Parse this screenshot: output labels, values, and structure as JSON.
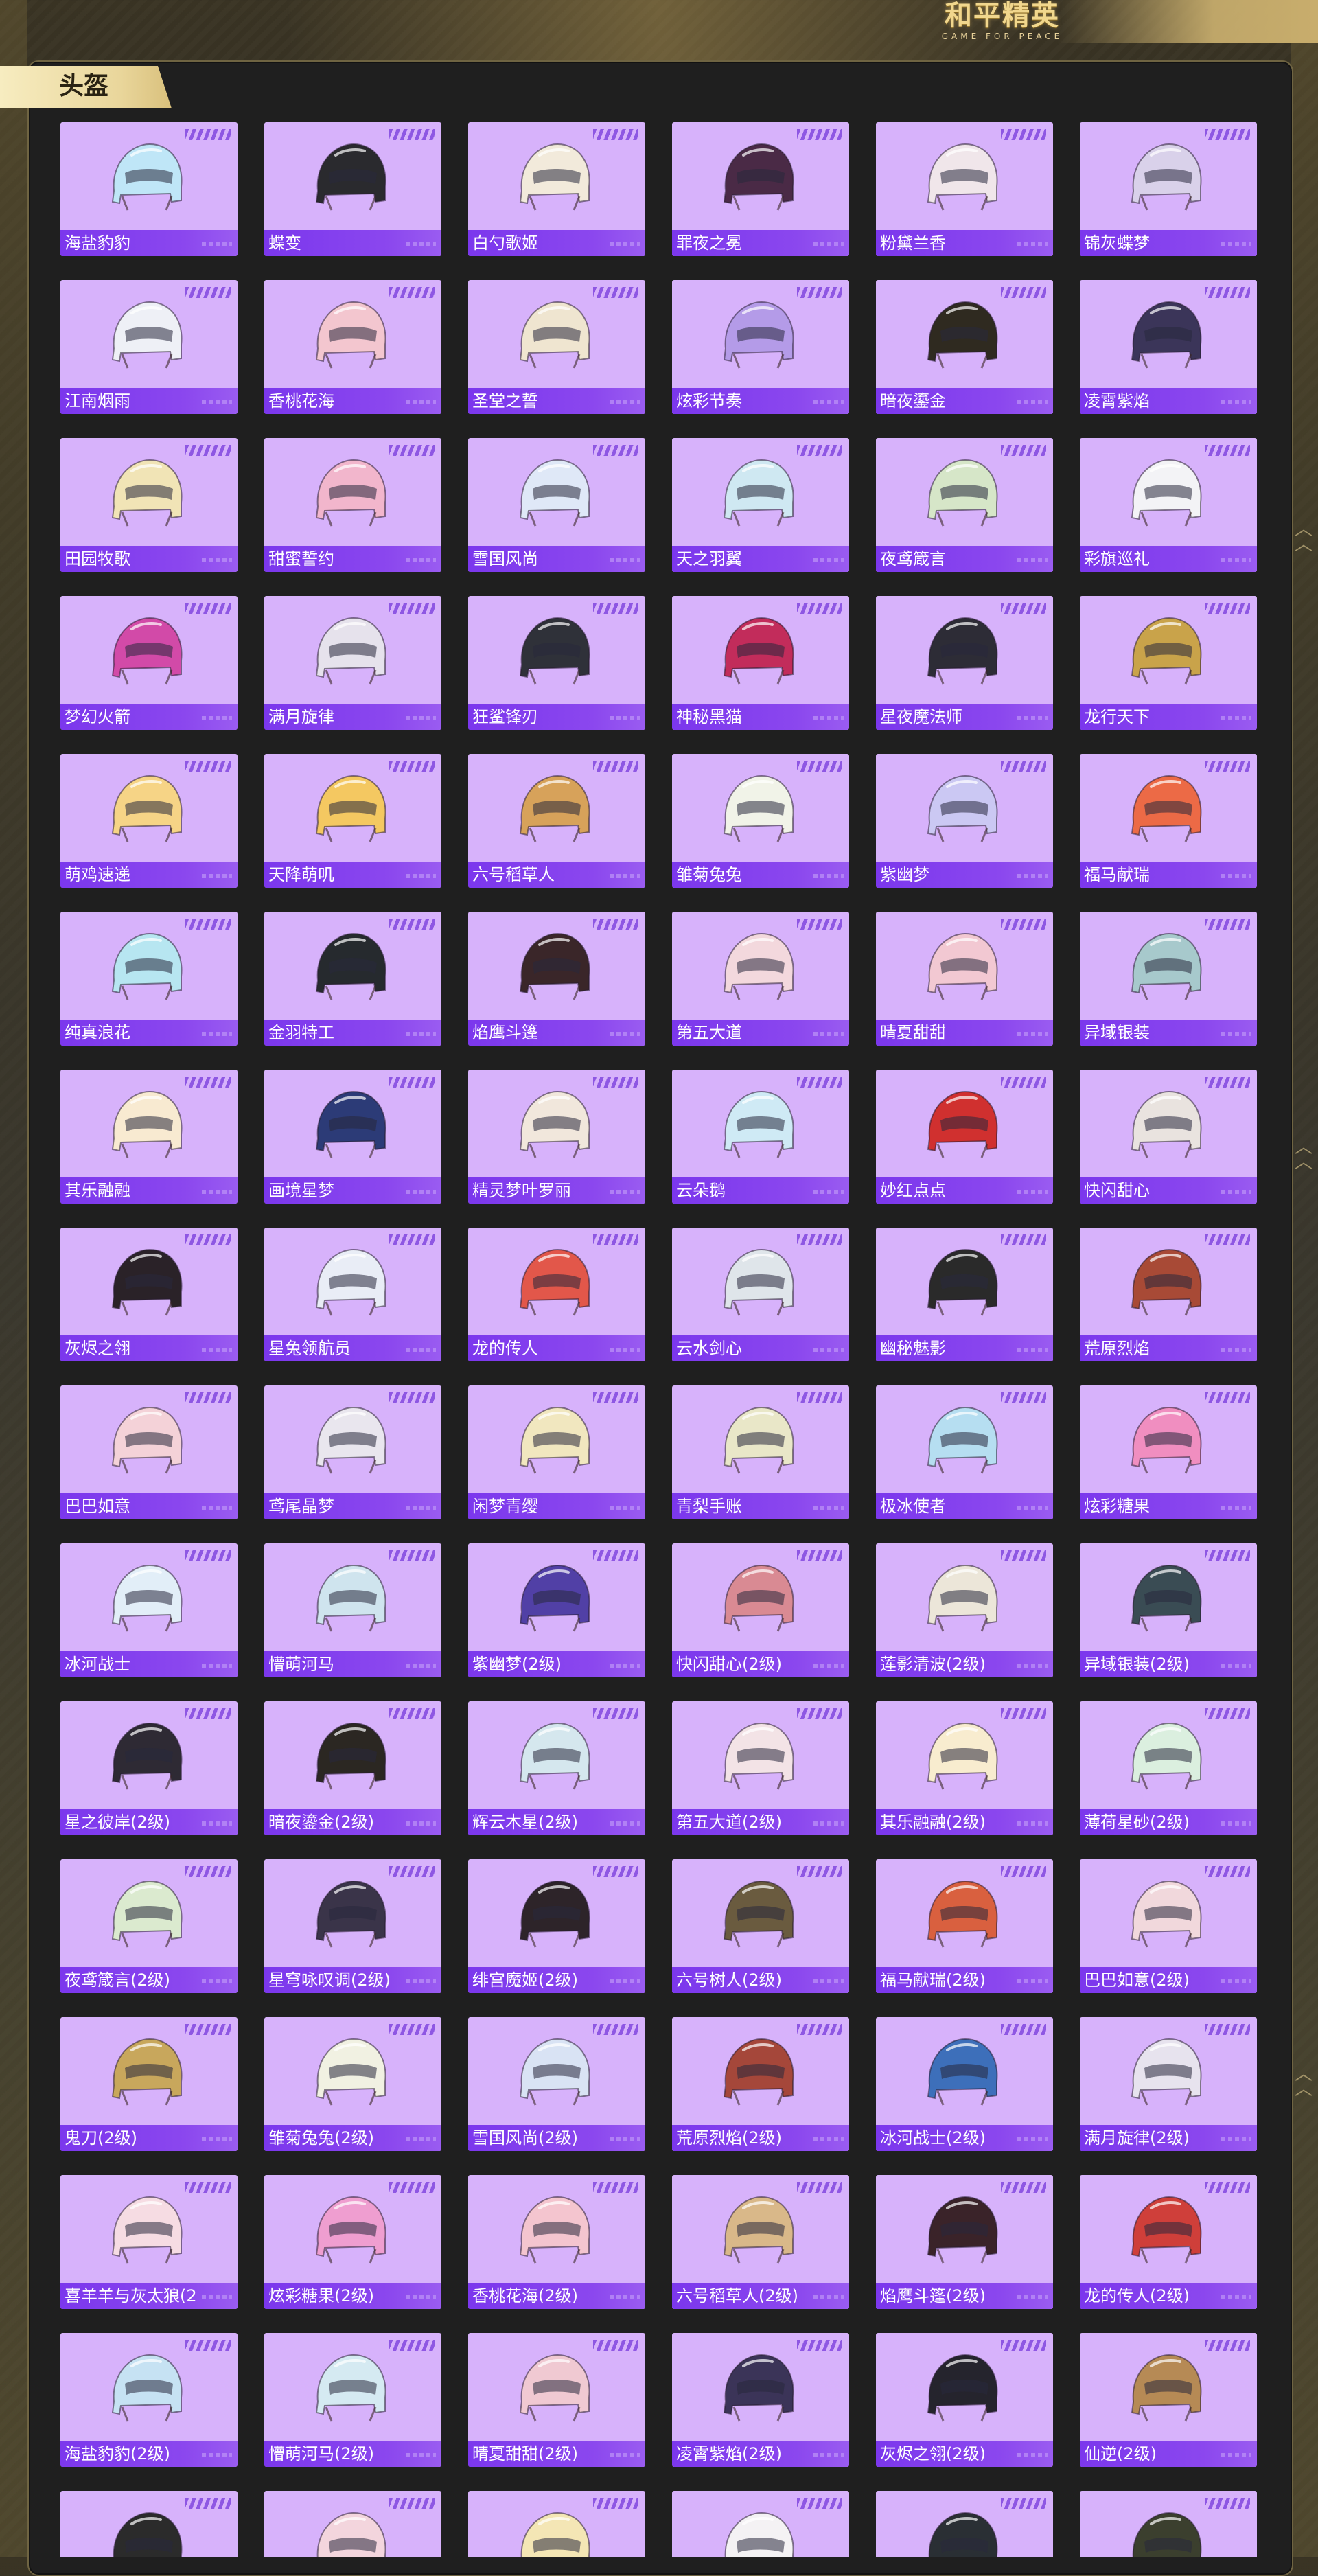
{
  "branding": {
    "logo_text": "和平精英",
    "logo_subtitle": "GAME FOR PEACE"
  },
  "section": {
    "title": "头盔"
  },
  "palette": {
    "card_bg": "#d7b2fb",
    "label_bar": "#7b37ed",
    "accent_gold": "#e9d69b"
  },
  "helmets": [
    {
      "name": "海盐豹豹",
      "icon": "helmet-icon",
      "color": "#bfe6f7"
    },
    {
      "name": "蝶变",
      "icon": "helmet-icon",
      "color": "#2a2a2e"
    },
    {
      "name": "白勺歌姬",
      "icon": "helmet-icon",
      "color": "#f2eadb"
    },
    {
      "name": "罪夜之冕",
      "icon": "helmet-icon",
      "color": "#4a2a46"
    },
    {
      "name": "粉黛兰香",
      "icon": "helmet-icon",
      "color": "#f0e6ea"
    },
    {
      "name": "锦灰蝶梦",
      "icon": "helmet-icon",
      "color": "#d9d1ea"
    },
    {
      "name": "江南烟雨",
      "icon": "helmet-icon",
      "color": "#eef0f6"
    },
    {
      "name": "香桃花海",
      "icon": "helmet-icon",
      "color": "#f3c6cf"
    },
    {
      "name": "圣堂之誓",
      "icon": "helmet-icon",
      "color": "#efe5d0"
    },
    {
      "name": "炫彩节奏",
      "icon": "helmet-icon",
      "color": "#b49be8"
    },
    {
      "name": "暗夜鎏金",
      "icon": "helmet-icon",
      "color": "#2f2a20"
    },
    {
      "name": "凌霄紫焰",
      "icon": "helmet-icon",
      "color": "#3b3559"
    },
    {
      "name": "田园牧歌",
      "icon": "helmet-icon",
      "color": "#f1e4b6"
    },
    {
      "name": "甜蜜誓约",
      "icon": "helmet-icon",
      "color": "#f2b6cc"
    },
    {
      "name": "雪国风尚",
      "icon": "helmet-icon",
      "color": "#dfe8f7"
    },
    {
      "name": "天之羽翼",
      "icon": "helmet-icon",
      "color": "#cfe8f2"
    },
    {
      "name": "夜鸢箴言",
      "icon": "helmet-icon",
      "color": "#d6e6c8"
    },
    {
      "name": "彩旗巡礼",
      "icon": "helmet-icon",
      "color": "#f3f3f6"
    },
    {
      "name": "梦幻火箭",
      "icon": "helmet-icon",
      "color": "#d24aa8"
    },
    {
      "name": "满月旋律",
      "icon": "helmet-icon",
      "color": "#e6e2ec"
    },
    {
      "name": "狂鲨锋刃",
      "icon": "helmet-icon",
      "color": "#2f3139"
    },
    {
      "name": "神秘黑猫",
      "icon": "helmet-icon",
      "color": "#c22c5b"
    },
    {
      "name": "星夜魔法师",
      "icon": "helmet-icon",
      "color": "#2d2c36"
    },
    {
      "name": "龙行天下",
      "icon": "helmet-icon",
      "color": "#c9a34a"
    },
    {
      "name": "萌鸡速递",
      "icon": "helmet-icon",
      "color": "#f6d486"
    },
    {
      "name": "天降萌叽",
      "icon": "helmet-icon",
      "color": "#f4c861"
    },
    {
      "name": "六号稻草人",
      "icon": "helmet-icon",
      "color": "#d7a25a"
    },
    {
      "name": "雏菊兔兔",
      "icon": "helmet-icon",
      "color": "#f1f3e8"
    },
    {
      "name": "紫幽梦",
      "icon": "helmet-icon",
      "color": "#cbc8f3"
    },
    {
      "name": "福马献瑞",
      "icon": "helmet-icon",
      "color": "#ec6a46"
    },
    {
      "name": "纯真浪花",
      "icon": "helmet-icon",
      "color": "#b7e6f1"
    },
    {
      "name": "金羽特工",
      "icon": "helmet-icon",
      "color": "#262a2e"
    },
    {
      "name": "焰鹰斗篷",
      "icon": "helmet-icon",
      "color": "#3a2629"
    },
    {
      "name": "第五大道",
      "icon": "helmet-icon",
      "color": "#f3d8dd"
    },
    {
      "name": "晴夏甜甜",
      "icon": "helmet-icon",
      "color": "#f2c8d2"
    },
    {
      "name": "异域银装",
      "icon": "helmet-icon",
      "color": "#a7c9cc"
    },
    {
      "name": "其乐融融",
      "icon": "helmet-icon",
      "color": "#f8ead1"
    },
    {
      "name": "画境星梦",
      "icon": "helmet-icon",
      "color": "#2c3b77"
    },
    {
      "name": "精灵梦叶罗丽",
      "icon": "helmet-icon",
      "color": "#f1e7dc"
    },
    {
      "name": "云朵鹅",
      "icon": "helmet-icon",
      "color": "#cfeaf5"
    },
    {
      "name": "妙红点点",
      "icon": "helmet-icon",
      "color": "#d0302f"
    },
    {
      "name": "快闪甜心",
      "icon": "helmet-icon",
      "color": "#e9e3df"
    },
    {
      "name": "灰烬之翎",
      "icon": "helmet-icon",
      "color": "#2a2228"
    },
    {
      "name": "星兔领航员",
      "icon": "helmet-icon",
      "color": "#e9edf6"
    },
    {
      "name": "龙的传人",
      "icon": "helmet-icon",
      "color": "#e2574a"
    },
    {
      "name": "云水剑心",
      "icon": "helmet-icon",
      "color": "#dfe5ea"
    },
    {
      "name": "幽秘魅影",
      "icon": "helmet-icon",
      "color": "#2a2a2a"
    },
    {
      "name": "荒原烈焰",
      "icon": "helmet-icon",
      "color": "#a84a36"
    },
    {
      "name": "巴巴如意",
      "icon": "helmet-icon",
      "color": "#f4d2d8"
    },
    {
      "name": "鸢尾晶梦",
      "icon": "helmet-icon",
      "color": "#e9e6ee"
    },
    {
      "name": "闲梦青缨",
      "icon": "helmet-icon",
      "color": "#f1e7bf"
    },
    {
      "name": "青梨手账",
      "icon": "helmet-icon",
      "color": "#e9e7c8"
    },
    {
      "name": "极冰使者",
      "icon": "helmet-icon",
      "color": "#b6def1"
    },
    {
      "name": "炫彩糖果",
      "icon": "helmet-icon",
      "color": "#f08ec0"
    },
    {
      "name": "冰河战士",
      "icon": "helmet-icon",
      "color": "#e2eef8"
    },
    {
      "name": "懵萌河马",
      "icon": "helmet-icon",
      "color": "#cfe4ee"
    },
    {
      "name": "紫幽梦(2级)",
      "icon": "helmet-icon",
      "color": "#5140a6"
    },
    {
      "name": "快闪甜心(2级)",
      "icon": "helmet-icon",
      "color": "#d98a93"
    },
    {
      "name": "莲影清波(2级)",
      "icon": "helmet-icon",
      "color": "#ece6d9"
    },
    {
      "name": "异域银装(2级)",
      "icon": "helmet-icon",
      "color": "#3a4c54"
    },
    {
      "name": "星之彼岸(2级)",
      "icon": "helmet-icon",
      "color": "#2e2a34"
    },
    {
      "name": "暗夜鎏金(2级)",
      "icon": "helmet-icon",
      "color": "#2b2722"
    },
    {
      "name": "辉云木星(2级)",
      "icon": "helmet-icon",
      "color": "#d5e7ee"
    },
    {
      "name": "第五大道(2级)",
      "icon": "helmet-icon",
      "color": "#f3e3e6"
    },
    {
      "name": "其乐融融(2级)",
      "icon": "helmet-icon",
      "color": "#f8eccf"
    },
    {
      "name": "薄荷星砂(2级)",
      "icon": "helmet-icon",
      "color": "#dbefdf"
    },
    {
      "name": "夜鸢箴言(2级)",
      "icon": "helmet-icon",
      "color": "#dbeacf"
    },
    {
      "name": "星穹咏叹调(2级)",
      "icon": "helmet-icon",
      "color": "#3a3449"
    },
    {
      "name": "绯宫魔姬(2级)",
      "icon": "helmet-icon",
      "color": "#2d2429"
    },
    {
      "name": "六号树人(2级)",
      "icon": "helmet-icon",
      "color": "#6a5b3f"
    },
    {
      "name": "福马献瑞(2级)",
      "icon": "helmet-icon",
      "color": "#d9603f"
    },
    {
      "name": "巴巴如意(2级)",
      "icon": "helmet-icon",
      "color": "#f1d8dc"
    },
    {
      "name": "鬼刀(2级)",
      "icon": "helmet-icon",
      "color": "#c8a75c"
    },
    {
      "name": "雏菊兔兔(2级)",
      "icon": "helmet-icon",
      "color": "#f1f1e2"
    },
    {
      "name": "雪国风尚(2级)",
      "icon": "helmet-icon",
      "color": "#d9e3f4"
    },
    {
      "name": "荒原烈焰(2级)",
      "icon": "helmet-icon",
      "color": "#a5473a"
    },
    {
      "name": "冰河战士(2级)",
      "icon": "helmet-icon",
      "color": "#3d6fba"
    },
    {
      "name": "满月旋律(2级)",
      "icon": "helmet-icon",
      "color": "#e7e3ee"
    },
    {
      "name": "喜羊羊与灰太狼(2",
      "icon": "helmet-icon",
      "color": "#f6dce3"
    },
    {
      "name": "炫彩糖果(2级)",
      "icon": "helmet-icon",
      "color": "#ef9ed0"
    },
    {
      "name": "香桃花海(2级)",
      "icon": "helmet-icon",
      "color": "#f4c5cf"
    },
    {
      "name": "六号稻草人(2级)",
      "icon": "helmet-icon",
      "color": "#d9b889"
    },
    {
      "name": "焰鹰斗篷(2级)",
      "icon": "helmet-icon",
      "color": "#3a2329"
    },
    {
      "name": "龙的传人(2级)",
      "icon": "helmet-icon",
      "color": "#cf3f3a"
    },
    {
      "name": "海盐豹豹(2级)",
      "icon": "helmet-icon",
      "color": "#c6e2f3"
    },
    {
      "name": "懵萌河马(2级)",
      "icon": "helmet-icon",
      "color": "#d5eaf2"
    },
    {
      "name": "晴夏甜甜(2级)",
      "icon": "helmet-icon",
      "color": "#f0c9d2"
    },
    {
      "name": "凌霄紫焰(2级)",
      "icon": "helmet-icon",
      "color": "#3b3458"
    },
    {
      "name": "灰烬之翎(2级)",
      "icon": "helmet-icon",
      "color": "#25242d"
    },
    {
      "name": "仙逆(2级)",
      "icon": "helmet-icon",
      "color": "#b68a55"
    },
    {
      "name": "",
      "icon": "helmet-icon",
      "color": "#2b2b2b"
    },
    {
      "name": "",
      "icon": "helmet-icon",
      "color": "#f3d5dd"
    },
    {
      "name": "",
      "icon": "helmet-icon",
      "color": "#f4e6b5"
    },
    {
      "name": "",
      "icon": "helmet-icon",
      "color": "#f4f2f4"
    },
    {
      "name": "",
      "icon": "helmet-icon",
      "color": "#2a2f34"
    },
    {
      "name": "",
      "icon": "helmet-icon",
      "color": "#3b3f2e"
    }
  ]
}
